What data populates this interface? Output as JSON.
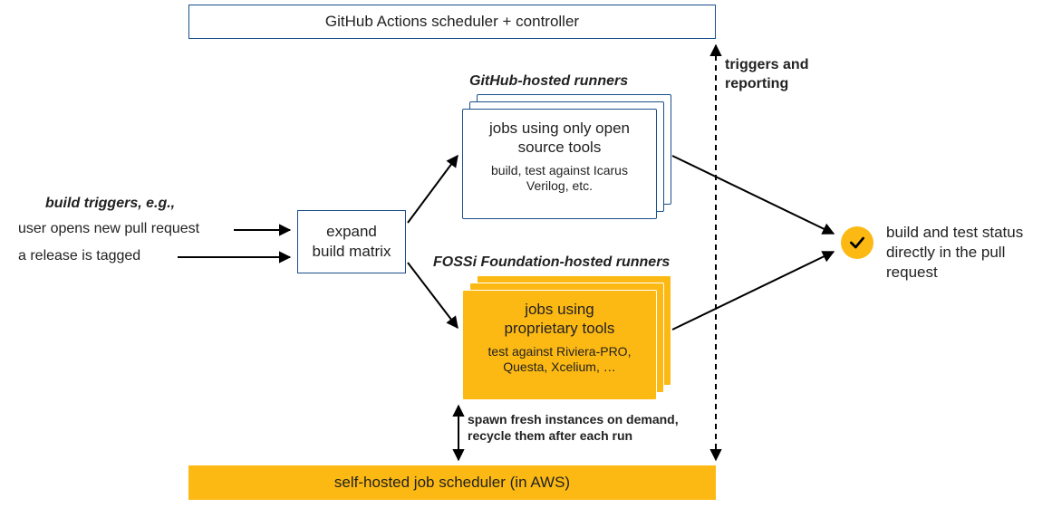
{
  "top_box": {
    "label": "GitHub Actions scheduler + controller"
  },
  "triggers": {
    "header": "build triggers, e.g.,",
    "line1": "user opens new pull request",
    "line2": "a release is tagged"
  },
  "expand_box": {
    "line1": "expand",
    "line2": "build matrix"
  },
  "github_runners_header": "GitHub-hosted runners",
  "open_source_card": {
    "title1": "jobs using only open",
    "title2": "source tools",
    "sub1": "build, test against Icarus",
    "sub2": "Verilog, etc."
  },
  "fossi_runners_header": "FOSSi Foundation-hosted runners",
  "proprietary_card": {
    "title1": "jobs using",
    "title2": "proprietary tools",
    "sub1": "test against Riviera-PRO,",
    "sub2": "Questa, Xcelium, …"
  },
  "triggers_reporting": {
    "line1": "triggers and",
    "line2": "reporting"
  },
  "spawn_label": {
    "line1": "spawn fresh instances on demand,",
    "line2": "recycle them after each run"
  },
  "bottom_box": {
    "label": "self-hosted job scheduler (in AWS)"
  },
  "status_text": {
    "line1": "build and test status",
    "line2": "directly in the pull request"
  }
}
